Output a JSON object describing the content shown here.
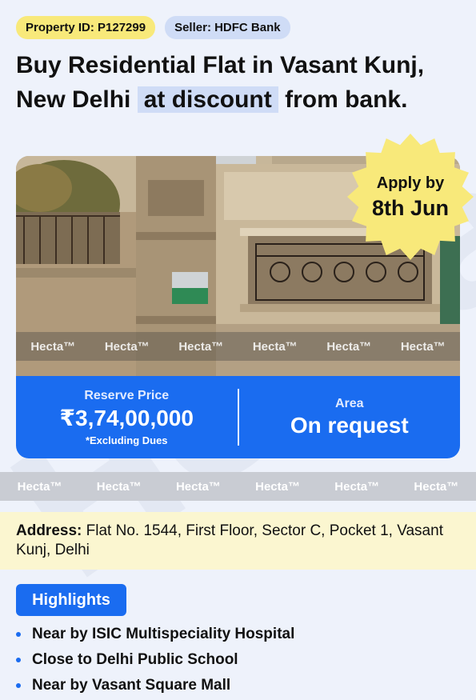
{
  "tags": {
    "property_id": "Property ID: P127299",
    "seller": "Seller: HDFC Bank"
  },
  "title": {
    "line1": "Buy Residential Flat in Vasant Kunj,",
    "line2_prefix": "New Delhi",
    "line2_highlight": "at discount",
    "line2_suffix": "from bank."
  },
  "badge": {
    "line1": "Apply by",
    "line2": "8th Jun",
    "color": "#f8e97a"
  },
  "watermark": {
    "text": "Hecta™",
    "big_text": "Hecta™"
  },
  "price_panel": {
    "reserve_label": "Reserve Price",
    "reserve_value": "₹3,74,00,000",
    "reserve_note": "*Excluding Dues",
    "area_label": "Area",
    "area_value": "On request",
    "color": "#1a6cf0"
  },
  "address": {
    "label": "Address:",
    "value": "Flat No. 1544, First Floor, Sector C, Pocket 1, Vasant Kunj, Delhi"
  },
  "highlights": {
    "button": "Highlights",
    "items": [
      "Near by ISIC Multispeciality Hospital",
      "Close to Delhi Public School",
      "Near by Vasant Square Mall"
    ]
  }
}
